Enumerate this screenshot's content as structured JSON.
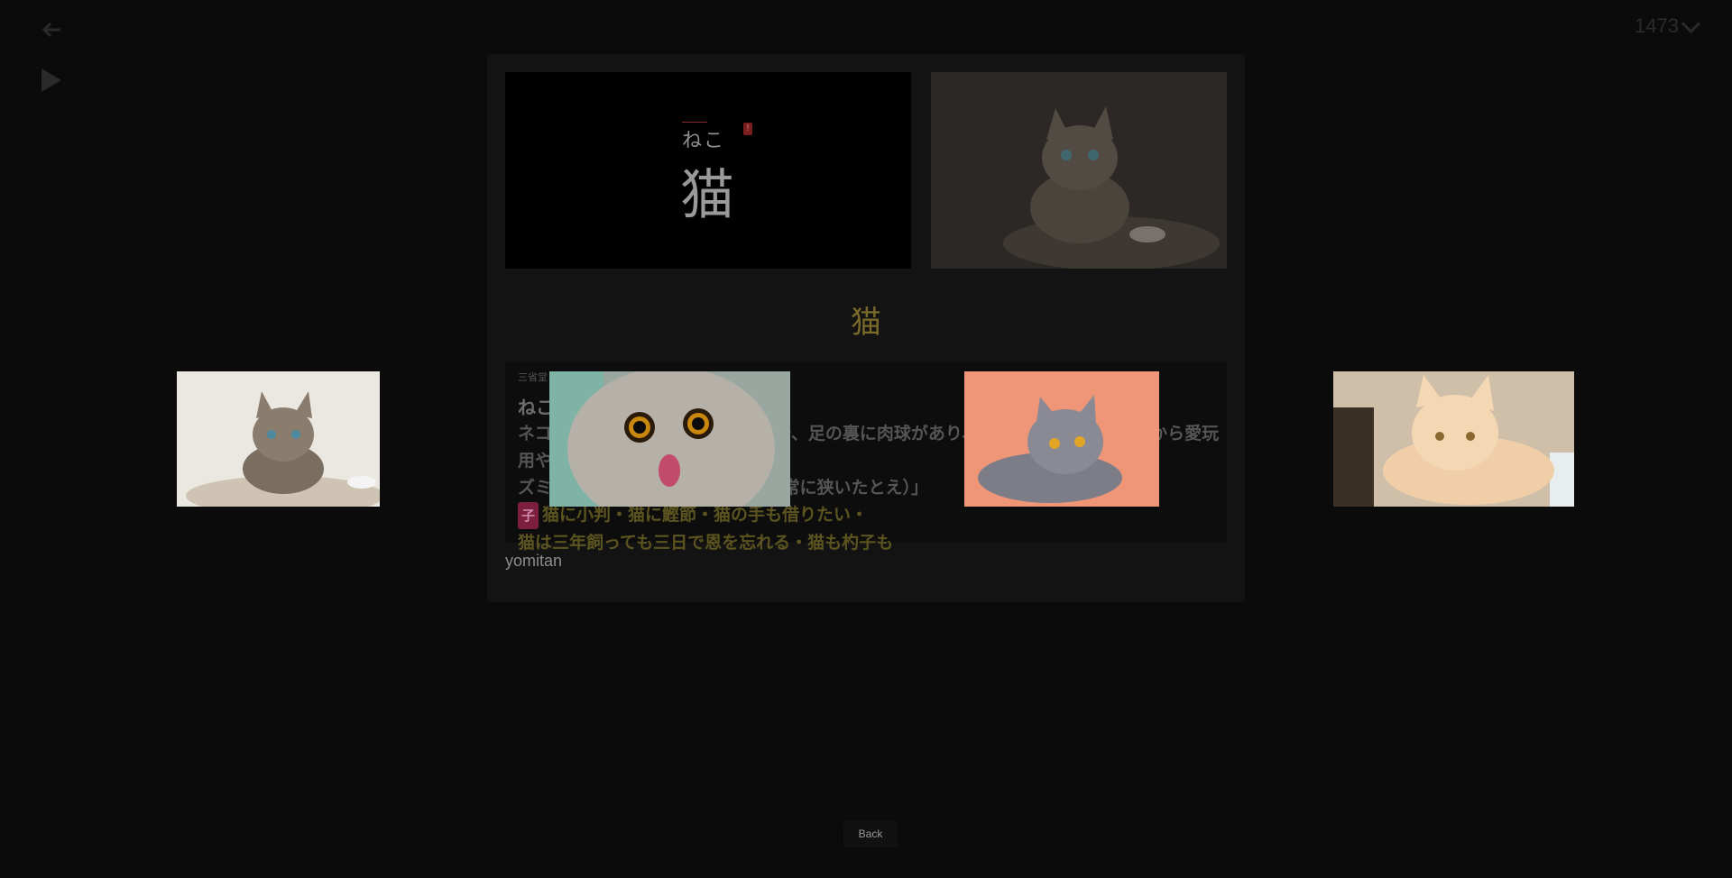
{
  "controls": {
    "undo_icon": "undo-icon",
    "play_icon": "play-icon"
  },
  "counter": {
    "value": "1473"
  },
  "card": {
    "reading": "ねこ",
    "pitch_badge": "!",
    "expression": "猫",
    "headword": "猫",
    "dictionary_name": "三省堂",
    "entry_head": "ねこ",
    "definition_line1": "ネコ科の哺乳類。性質はしなやかで、足の裏に肉球があり、音を立てずに歩く。昔から愛玩用やネ",
    "definition_line2": "ズミ退治に飼われる。「猫の額（非常に狭いたとえ）」",
    "tag_label": "子",
    "phrases_line1": "猫に小判・猫に鰹節・猫の手も借りたい・",
    "phrases_line2": "猫は三年飼っても三日で恩を忘れる・猫も杓子も",
    "source": "yomitan"
  },
  "colors": {
    "accent_gold": "#7a6a2a",
    "tag_bg": "#7c1f3e",
    "pitch_red": "#7a1d1d"
  },
  "back_button": {
    "label": "Back"
  }
}
